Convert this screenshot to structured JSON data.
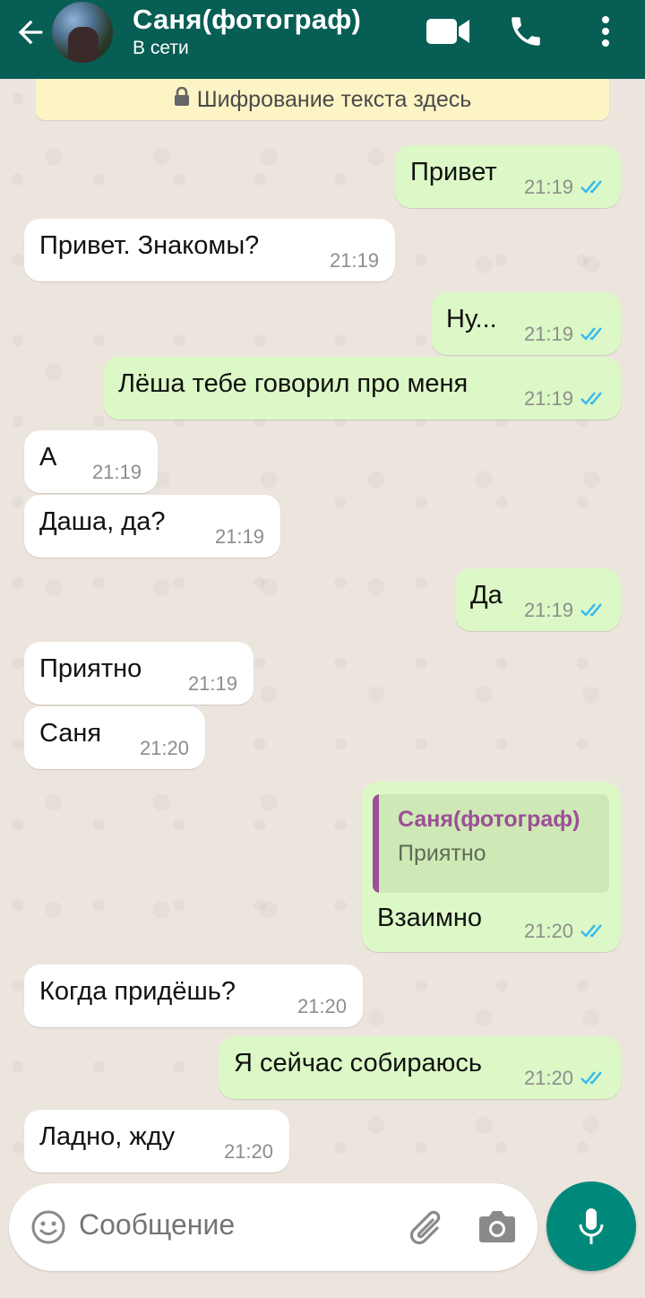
{
  "header": {
    "contact_name": "Саня(фотограф)",
    "status": "В сети",
    "icons": [
      "back-arrow-icon",
      "avatar",
      "video-call-icon",
      "phone-icon",
      "more-vert-icon"
    ],
    "color": "#075e54"
  },
  "encryption_notice": "Шифрование текста здесь",
  "messages": [
    {
      "dir": "out",
      "text": "Привет",
      "time": "21:19",
      "read": true
    },
    {
      "dir": "in",
      "text": "Привет. Знакомы?",
      "time": "21:19"
    },
    {
      "dir": "out",
      "text": "Ну...",
      "time": "21:19",
      "read": true
    },
    {
      "dir": "out",
      "text": "Лёша тебе говорил про меня",
      "time": "21:19",
      "read": true
    },
    {
      "dir": "in",
      "text": "А",
      "time": "21:19"
    },
    {
      "dir": "in",
      "text": "Даша, да?",
      "time": "21:19"
    },
    {
      "dir": "out",
      "text": "Да",
      "time": "21:19",
      "read": true
    },
    {
      "dir": "in",
      "text": "Приятно",
      "time": "21:19"
    },
    {
      "dir": "in",
      "text": "Саня",
      "time": "21:20"
    },
    {
      "dir": "out",
      "text": "Взаимно",
      "time": "21:20",
      "read": true,
      "quote": {
        "author": "Саня(фотограф)",
        "text": "Приятно"
      }
    },
    {
      "dir": "in",
      "text": "Когда придёшь?",
      "time": "21:20"
    },
    {
      "dir": "out",
      "text": "Я сейчас собираюсь",
      "time": "21:20",
      "read": true
    },
    {
      "dir": "in",
      "text": "Ладно, жду",
      "time": "21:20"
    }
  ],
  "composer": {
    "placeholder": "Сообщение",
    "icons": [
      "emoji-icon",
      "attach-icon",
      "camera-icon",
      "mic-icon"
    ]
  },
  "colors": {
    "incoming_bubble": "#ffffff",
    "outgoing_bubble": "#dcf8c6",
    "read_ticks": "#34b7f1",
    "quote_author": "#9c4f96",
    "mic_button": "#00897b"
  }
}
